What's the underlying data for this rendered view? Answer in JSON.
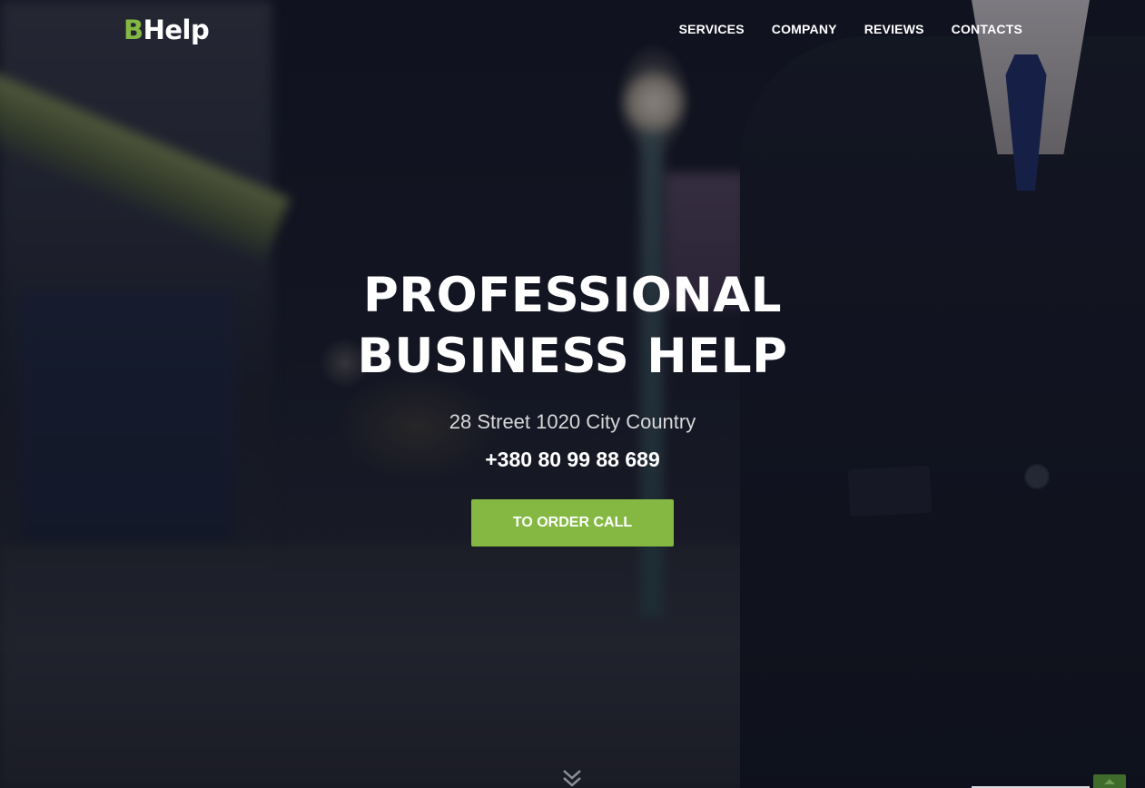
{
  "header": {
    "logo_b": "B",
    "logo_rest": "Help",
    "nav": [
      {
        "label": "SERVICES"
      },
      {
        "label": "COMPANY"
      },
      {
        "label": "REVIEWS"
      },
      {
        "label": "CONTACTS"
      }
    ]
  },
  "hero": {
    "title_line1": "PROFESSIONAL",
    "title_line2": "BUSINESS HELP",
    "address": "28 Street 1020 City Country",
    "phone": "+380 80 99 88 689",
    "cta_label": "TO ORDER CALL"
  },
  "colors": {
    "accent": "#84b843",
    "text": "#ffffff"
  },
  "icons": {
    "scroll": "double-chevron-down-icon",
    "to_top": "arrow-up-icon"
  }
}
